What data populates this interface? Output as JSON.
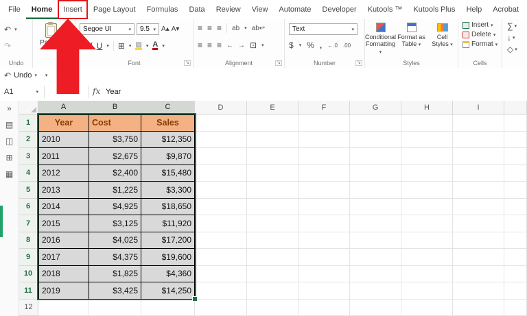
{
  "app": "Microsoft Excel",
  "tabs": {
    "items": [
      "File",
      "Home",
      "Insert",
      "Page Layout",
      "Formulas",
      "Data",
      "Review",
      "View",
      "Automate",
      "Developer",
      "Kutools ™",
      "Kutools Plus",
      "Help",
      "Acrobat"
    ],
    "active_index": 1,
    "highlighted_index": 2
  },
  "ribbon": {
    "group_labels": {
      "undo": "Undo",
      "font": "Font",
      "alignment": "Alignment",
      "number": "Number",
      "styles": "Styles",
      "cells": "Cells"
    },
    "paste_label": "Paste",
    "font_name": "Segoe UI",
    "font_size": "9.5",
    "number_format": "Text",
    "conditional_formatting": [
      "Conditional",
      "Formatting"
    ],
    "format_as_table": [
      "Format as",
      "Table"
    ],
    "cell_styles": [
      "Cell",
      "Styles"
    ],
    "cells_insert": "Insert",
    "cells_delete": "Delete",
    "cells_format": "Format"
  },
  "qat": {
    "undo_label": "Undo"
  },
  "formula_bar": {
    "name_box": "A1",
    "fx": "fx",
    "value": "Year"
  },
  "sheet": {
    "column_headers": [
      "A",
      "B",
      "C",
      "D",
      "E",
      "F",
      "G",
      "H",
      "I"
    ],
    "visible_rows": 12,
    "selected_range": "A1:C11",
    "table": {
      "headers": [
        "Year",
        "Cost",
        "Sales"
      ],
      "rows": [
        [
          "2010",
          "$3,750",
          "$12,350"
        ],
        [
          "2011",
          "$2,675",
          "$9,870"
        ],
        [
          "2012",
          "$2,400",
          "$15,480"
        ],
        [
          "2013",
          "$1,225",
          "$3,300"
        ],
        [
          "2014",
          "$4,925",
          "$18,650"
        ],
        [
          "2015",
          "$3,125",
          "$11,920"
        ],
        [
          "2016",
          "$4,025",
          "$17,200"
        ],
        [
          "2017",
          "$4,375",
          "$19,600"
        ],
        [
          "2018",
          "$1,825",
          "$4,360"
        ],
        [
          "2019",
          "$3,425",
          "$14,250"
        ]
      ]
    }
  },
  "icons": {
    "undo": "↶",
    "redo": "↷",
    "dropdown": "▾",
    "chevrons_right": "»",
    "scissors": "✂",
    "copy": "▣",
    "format_painter": "◧",
    "bold": "B",
    "italic": "I",
    "underline": "U",
    "grow_font": "A▴",
    "shrink_font": "A▾",
    "borders": "⊞",
    "fill_color": "▨",
    "font_color": "A",
    "align": "≡",
    "orientation": "ab",
    "wrap_text": "ab↩",
    "merge": "⊡",
    "indent_left": "←",
    "indent_right": "→",
    "accounting": "$",
    "percent": "%",
    "comma": ",",
    "inc_decimal": "←.0",
    "dec_decimal": ".00",
    "sigma": "∑",
    "fill_down": "↓",
    "clear": "◇",
    "launcher": "↘",
    "pane": [
      "▤",
      "◫",
      "⊞",
      "▦"
    ]
  },
  "colors": {
    "excel_green": "#1E7145",
    "table_header_fill": "#F4B183",
    "table_header_text": "#833C00",
    "table_data_fill": "#D9D9D9",
    "annotation_red": "#EE1C25"
  }
}
